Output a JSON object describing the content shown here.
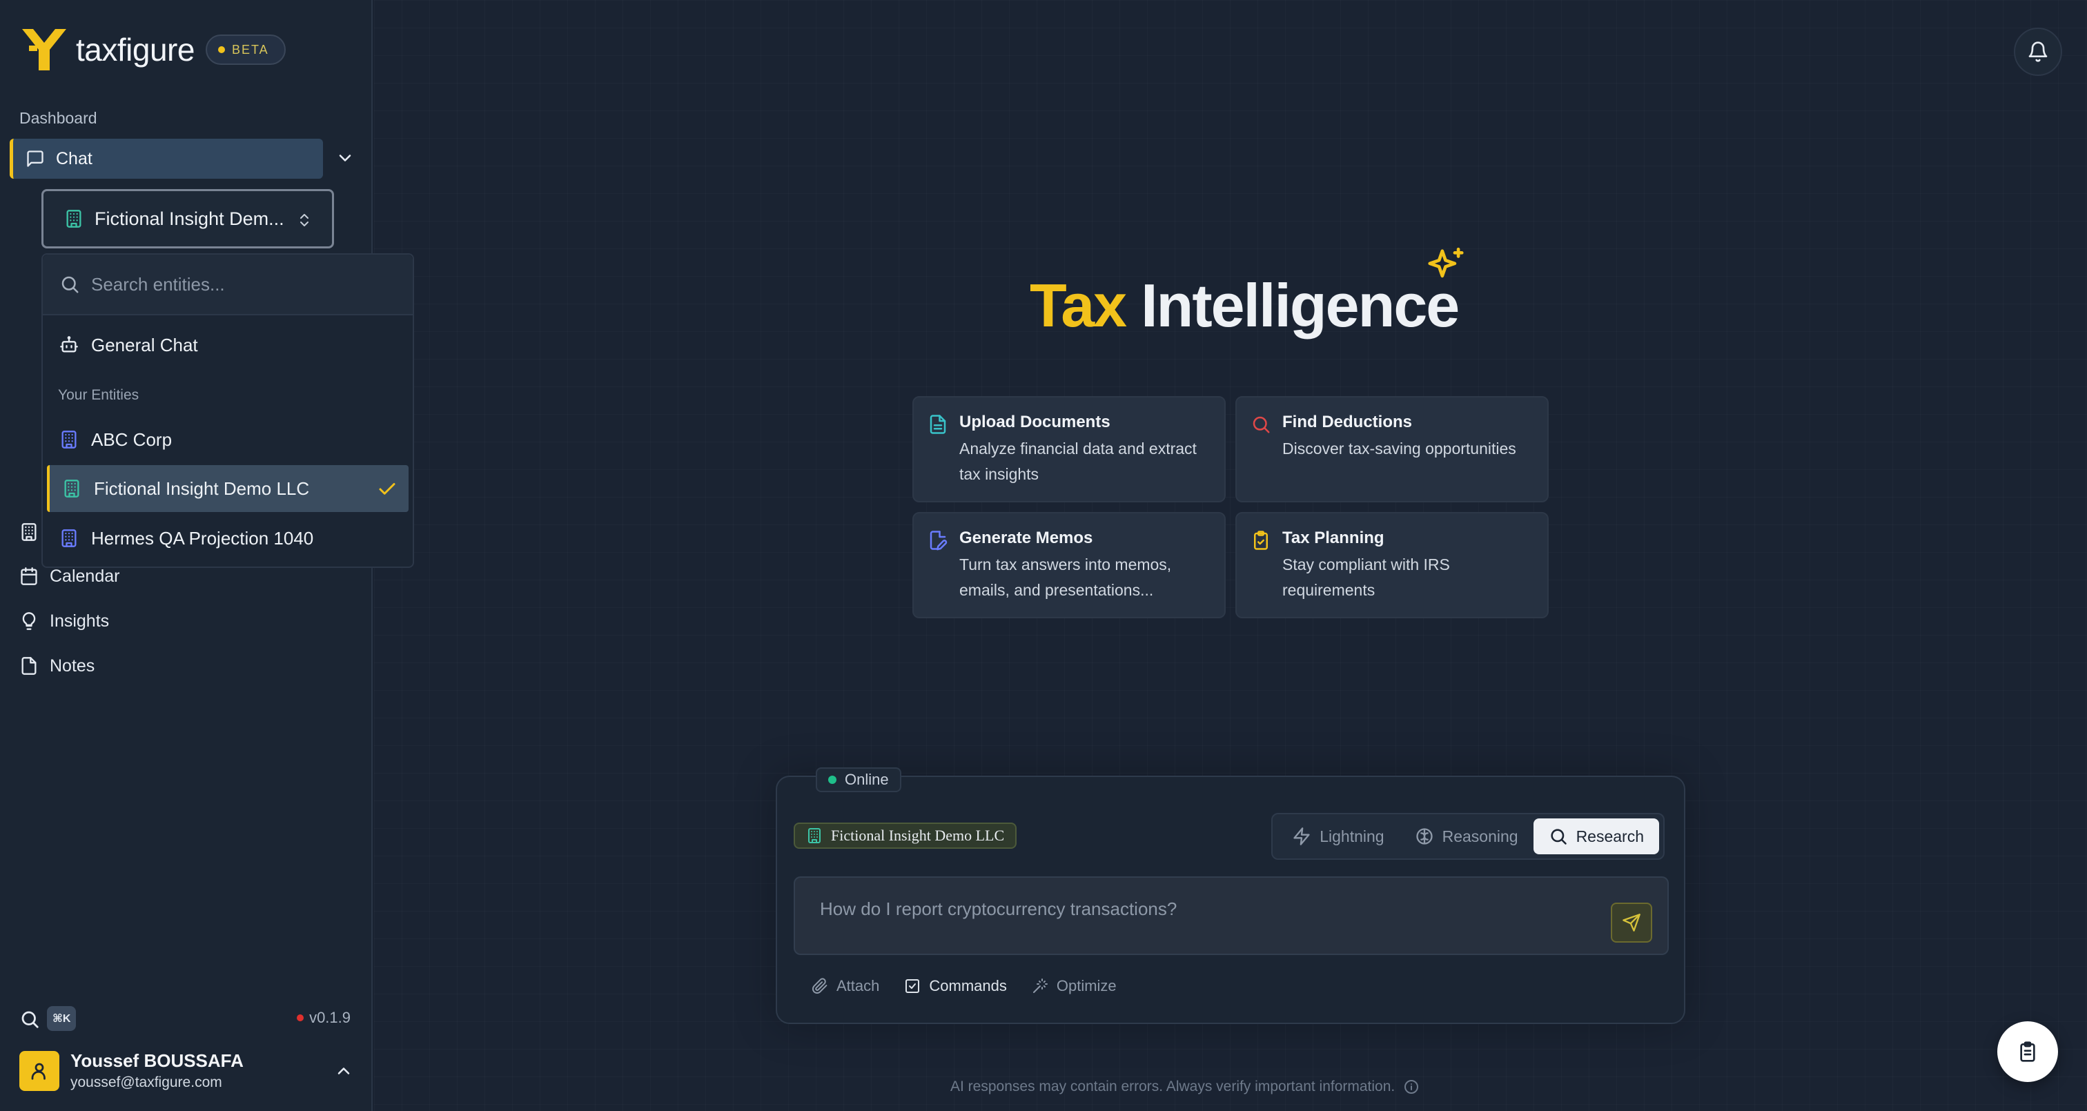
{
  "brand": {
    "name": "taxfigure",
    "badge": "BETA",
    "accent": "#f2c21b"
  },
  "sidebar": {
    "section_label": "Dashboard",
    "active_item": "Chat",
    "entity_select": {
      "value": "Fictional Insight Dem..."
    },
    "entity_dropdown": {
      "search_placeholder": "Search entities...",
      "general": "General Chat",
      "group_label": "Your Entities",
      "entities": [
        "ABC Corp",
        "Fictional Insight Demo LLC",
        "Hermes QA Projection 1040"
      ],
      "selected": "Fictional Insight Demo LLC"
    },
    "nav": [
      {
        "label": "Calendar",
        "icon": "calendar-icon"
      },
      {
        "label": "Insights",
        "icon": "lightbulb-icon"
      },
      {
        "label": "Notes",
        "icon": "file-icon"
      }
    ],
    "shortcut": "⌘K",
    "version": "v0.1.9",
    "user": {
      "name": "Youssef BOUSSAFA",
      "email": "youssef@taxfigure.com"
    }
  },
  "main": {
    "hero": {
      "tax": "Tax",
      "intelligence": "Intelligence"
    },
    "cards": [
      {
        "title": "Upload Documents",
        "desc": "Analyze financial data and extract tax insights",
        "icon": "document-icon",
        "color": "#39c3c9"
      },
      {
        "title": "Find Deductions",
        "desc": "Discover tax-saving opportunities",
        "icon": "search-icon",
        "color": "#e04848"
      },
      {
        "title": "Generate Memos",
        "desc": "Turn tax answers into memos, emails, and presentations...",
        "icon": "file-edit-icon",
        "color": "#6a7cff"
      },
      {
        "title": "Tax Planning",
        "desc": "Stay compliant with IRS requirements",
        "icon": "clipboard-check-icon",
        "color": "#f2c21b"
      }
    ],
    "composer": {
      "status": "Online",
      "entity_chip": "Fictional Insight Demo LLC",
      "modes": [
        "Lightning",
        "Reasoning",
        "Research"
      ],
      "active_mode": "Research",
      "placeholder": "How do I report cryptocurrency transactions?",
      "tools": [
        "Attach",
        "Commands",
        "Optimize"
      ]
    },
    "disclaimer": "AI responses may contain errors. Always verify important information."
  }
}
